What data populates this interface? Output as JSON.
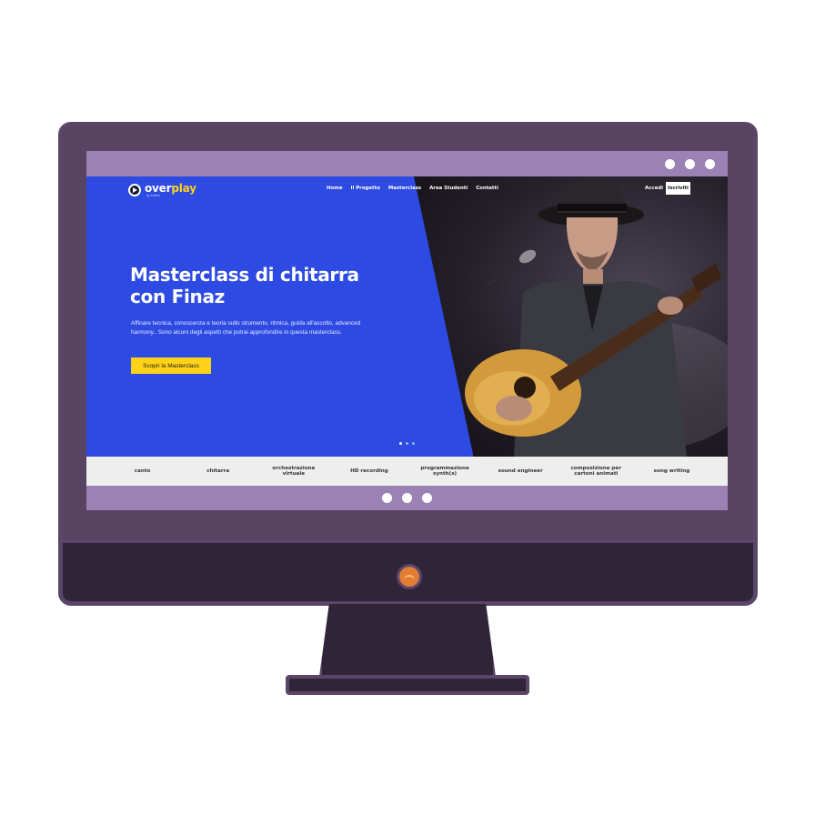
{
  "window": {
    "dots": [
      "dot",
      "dot",
      "dot"
    ]
  },
  "site": {
    "logo": {
      "name_part1": "over",
      "name_part2": "play",
      "sub": "by tudelcl"
    },
    "nav": [
      "Home",
      "Il Progetto",
      "Masterclass",
      "Area Studenti",
      "Contatti"
    ],
    "login_label": "Accedi",
    "signup_label": "Iscriviti",
    "hero": {
      "title_line1": "Masterclass di chitarra",
      "title_line2": "con Finaz",
      "description": "Affinare tecnica, conoscenza e teoria sullo strumento, ritmica, guida all'ascolto, advanced harmony.. Sono alcuni degli aspetti che potrai approfondire in questa masterclass.",
      "cta_label": "Scopri la Masterclass",
      "slider": {
        "count": 3,
        "active": 1
      }
    },
    "categories": [
      "canto",
      "chitarra",
      "orchestrazione virtuale",
      "HD recording",
      "programmazione synth(s)",
      "sound engineer",
      "composizione per cartoni animati",
      "song writing"
    ]
  },
  "colors": {
    "hero_blue": "#2d4ae3",
    "accent_yellow": "#ffd21a",
    "monitor_frame": "#2f2438",
    "screen_bar": "#9c81b5",
    "power_button": "#e27d35"
  },
  "icons": {
    "logo": "play-circle-icon",
    "power": "power-button-icon"
  }
}
